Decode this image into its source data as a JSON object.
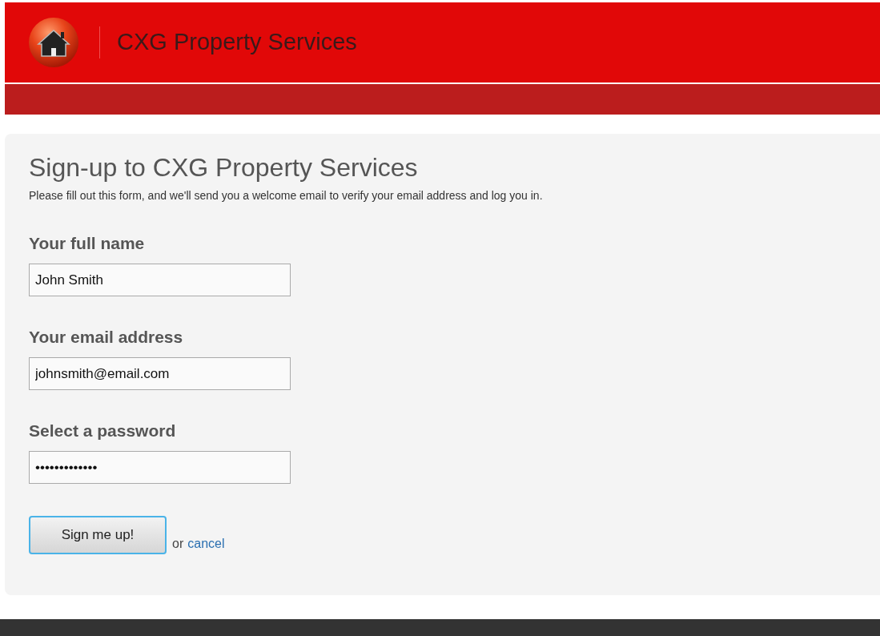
{
  "header": {
    "title": "CXG Property Services"
  },
  "form": {
    "title": "Sign-up to CXG Property Services",
    "intro": "Please fill out this form, and we'll send you a welcome email to verify your email address and log you in.",
    "fields": [
      {
        "label": "Your full name",
        "value": "John Smith"
      },
      {
        "label": "Your email address",
        "value": "johnsmith@email.com"
      },
      {
        "label": "Select a password",
        "value": "•••••••••••••"
      }
    ],
    "submit": "Sign me up!",
    "or": "or",
    "cancel": "cancel"
  }
}
